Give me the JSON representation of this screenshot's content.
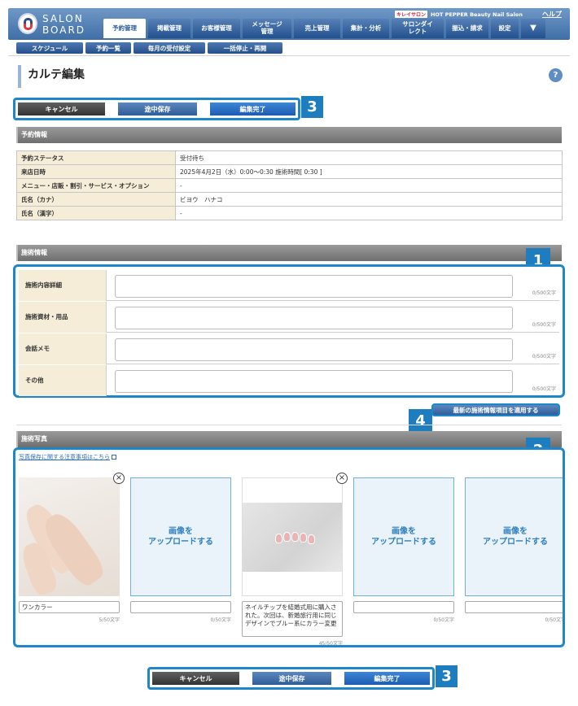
{
  "header": {
    "logo_top": "SALON",
    "logo_bottom": "BOARD",
    "brand_badge": "キレイサロン",
    "brand_name": "HOT PEPPER Beauty Nail Salon",
    "help_link": "ヘルプ",
    "nav": [
      "予約管理",
      "掲載管理",
      "お客様管理",
      "メッセージ管理",
      "売上管理",
      "集計・分析",
      "サロンダイレクト",
      "振込・請求",
      "設定"
    ],
    "nav_active": "予約管理"
  },
  "subnav": [
    "スケジュール",
    "予約一覧",
    "毎月の受付設定",
    "一括停止・再開"
  ],
  "page_title": "カルテ編集",
  "help_icon": "?",
  "actions": {
    "cancel": "キャンセル",
    "save_draft": "途中保存",
    "complete": "編集完了"
  },
  "badges": {
    "one": "1",
    "two": "2",
    "three": "3",
    "four": "4"
  },
  "reservation": {
    "title": "予約情報",
    "rows": [
      {
        "label": "予約ステータス",
        "value": "受付待ち"
      },
      {
        "label": "来店日時",
        "value": "2025年4月2日（水）0:00〜0:30 施術時間[ 0:30 ]"
      },
      {
        "label": "メニュー・店販・割引・サービス・オプション",
        "value": "-"
      },
      {
        "label": "氏名（カナ）",
        "value": "ビヨウ　ハナコ"
      },
      {
        "label": "氏名（漢字）",
        "value": "-"
      }
    ]
  },
  "treatment": {
    "title": "施術情報",
    "rows": [
      {
        "label": "施術内容詳細",
        "value": "",
        "count": "0/500文字"
      },
      {
        "label": "施術資材・用品",
        "value": "",
        "count": "0/500文字"
      },
      {
        "label": "会話メモ",
        "value": "",
        "count": "0/500文字"
      },
      {
        "label": "その他",
        "value": "",
        "count": "0/500文字"
      }
    ],
    "apply_button": "最新の施術情報項目を適用する"
  },
  "photos": {
    "title": "施術写真",
    "note_link": "写真保存に関する注意事項はこちら",
    "upload_label": "画像を\nアップロードする",
    "items": [
      {
        "type": "image",
        "image": "hands-photo",
        "caption": "ワンカラー",
        "count": "5/50文字"
      },
      {
        "type": "upload",
        "caption": "",
        "count": "0/50文字"
      },
      {
        "type": "image",
        "image": "nail-tips-photo",
        "caption": "ネイルチップを結婚式用に購入された。次回は、新婚旅行用に同じデザインでブルー系にカラー変更",
        "count": "45/50文字"
      },
      {
        "type": "upload",
        "caption": "",
        "count": "0/50文字"
      },
      {
        "type": "upload",
        "caption": "",
        "count": "0/50文字"
      }
    ]
  },
  "colors": {
    "accent": "#1d87c9",
    "nav": "#23518f",
    "label_bg": "#f6edd8"
  }
}
